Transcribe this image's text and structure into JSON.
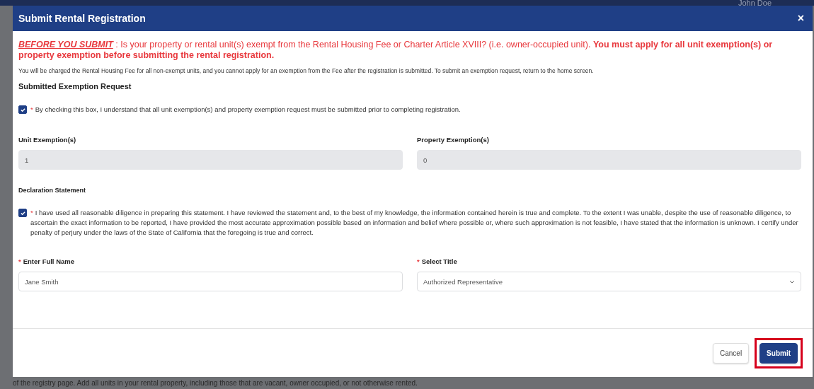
{
  "background": {
    "user_name": "John Doe",
    "footer_text": "of the registry page. Add all units in your rental property, including those that are vacant, owner occupied, or not otherwise rented."
  },
  "dialog": {
    "title": "Submit Rental Registration",
    "close": "×",
    "warning": {
      "lead": "BEFORE YOU SUBMIT",
      "text": " : Is your property or rental unit(s) exempt from the Rental Housing Fee or Charter Article XVIII? (i.e. owner-occupied unit). **You must apply for all unit exemption(s) or property exemption before submitting the rental registration.**"
    },
    "note": "You will be charged the Rental Housing Fee for all non-exempt units, and you cannot apply for an exemption from the Fee after the registration is submitted. To submit an exemption request, return to the home screen.",
    "exemption_section": {
      "heading": "Submitted Exemption Request",
      "acknowledgement": {
        "required_mark": "*",
        "text": "By checking this box, I understand that all unit exemption(s) and property exemption request must be submitted prior to completing registration.",
        "checked": true
      },
      "fields": [
        {
          "label": "Unit Exemption(s)",
          "value": "1"
        },
        {
          "label": "Property Exemption(s)",
          "value": "0"
        }
      ]
    },
    "declaration_section": {
      "heading": "Declaration Statement",
      "statement": {
        "required_mark": "*",
        "text": "I have used all reasonable diligence in preparing this statement. I have reviewed the statement and, to the best of my knowledge, the information contained herein is true and complete. To the extent I was unable, despite the use of reasonable diligence, to ascertain the exact information to be reported, I have provided the most accurate approximation possible based on information and belief where possible or, where such approximation is not feasible, I have stated that the information is unknown. I certify under penalty of perjury under the laws of the State of California that the foregoing is true and correct.",
        "checked": true
      },
      "fields": [
        {
          "kind": "text",
          "required_mark": "*",
          "label": "Enter Full Name",
          "value": "Jane Smith"
        },
        {
          "kind": "select",
          "required_mark": "*",
          "label": "Select Title",
          "value": "Authorized Representative"
        }
      ]
    },
    "buttons": [
      {
        "label": "Cancel",
        "kind": "secondary",
        "highlighted": false
      },
      {
        "label": "Submit",
        "kind": "primary",
        "highlighted": true
      }
    ]
  }
}
